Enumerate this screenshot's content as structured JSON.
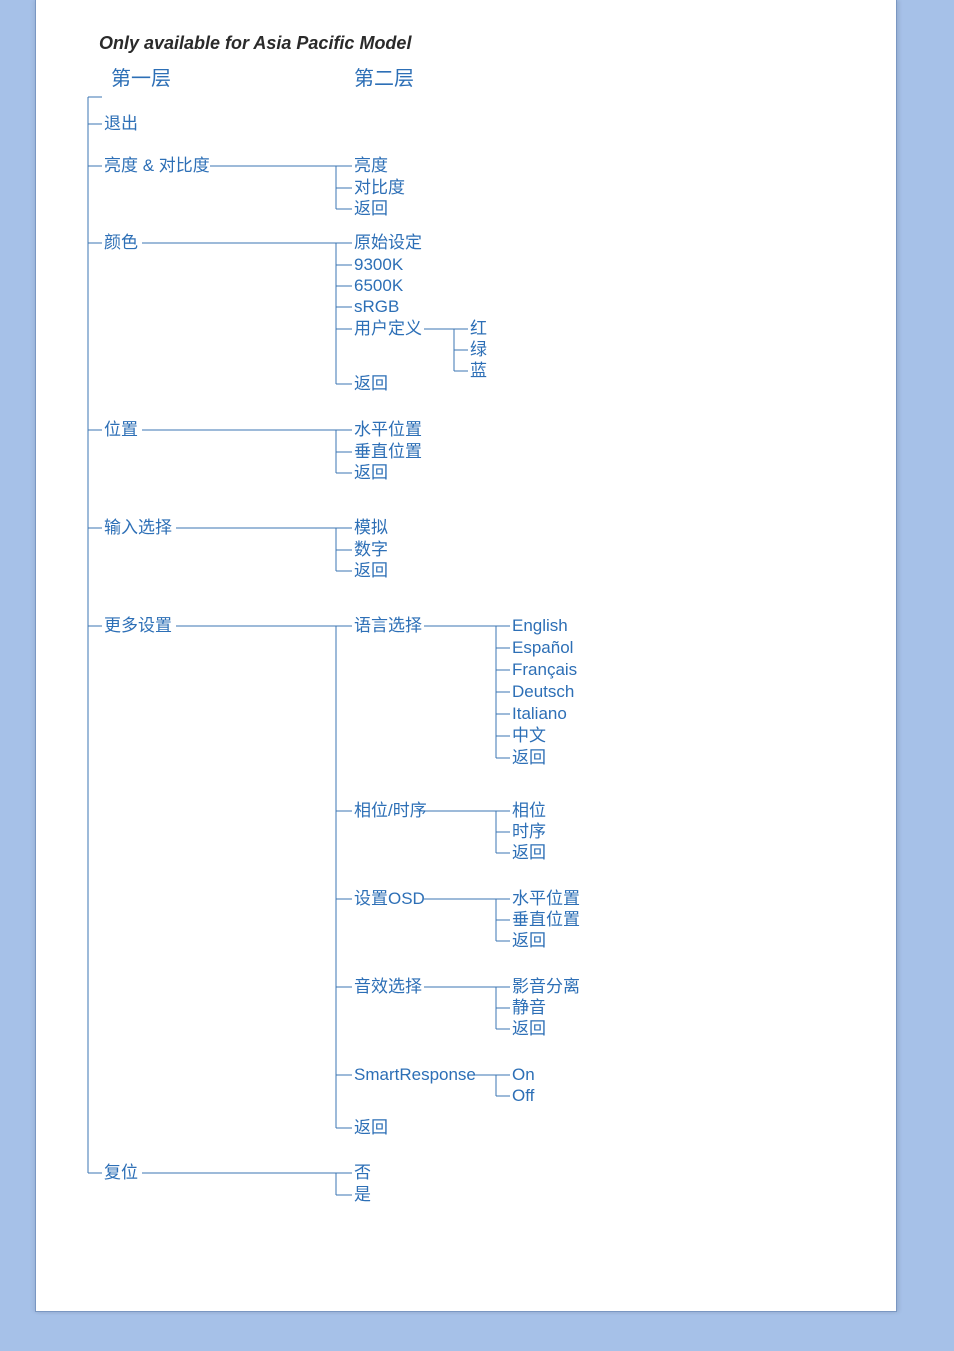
{
  "title": "Only available for Asia Pacific Model",
  "header_level1": "第一层",
  "header_level2": "第二层",
  "l1": {
    "exit": "退出",
    "brightness": "亮度 & 对比度",
    "color": "颜色",
    "position": "位置",
    "input": "输入选择",
    "more": "更多设置",
    "reset": "复位"
  },
  "brightness_sub": {
    "b": "亮度",
    "c": "对比度",
    "r": "返回"
  },
  "color_sub": {
    "orig": "原始设定",
    "k93": "9300K",
    "k65": "6500K",
    "srgb": "sRGB",
    "user": "用户定义",
    "ret": "返回"
  },
  "color_user_sub": {
    "r": "红",
    "g": "绿",
    "b": "蓝"
  },
  "position_sub": {
    "h": "水平位置",
    "v": "垂直位置",
    "r": "返回"
  },
  "input_sub": {
    "a": "模拟",
    "d": "数字",
    "r": "返回"
  },
  "more_sub": {
    "lang": "语言选择",
    "phase": "相位/时序",
    "osd": "设置OSD",
    "audio": "音效选择",
    "smart": "SmartResponse",
    "ret": "返回"
  },
  "lang_sub": {
    "en": "English",
    "es": "Español",
    "fr": "Français",
    "de": "Deutsch",
    "it": "Italiano",
    "zh": "中文",
    "ret": "返回"
  },
  "phase_sub": {
    "p": "相位",
    "c": "时序",
    "r": "返回"
  },
  "osd_sub": {
    "h": "水平位置",
    "v": "垂直位置",
    "r": "返回"
  },
  "audio_sub": {
    "sep": "影音分离",
    "mute": "静音",
    "r": "返回"
  },
  "smart_sub": {
    "on": "On",
    "off": "Off"
  },
  "reset_sub": {
    "no": "否",
    "yes": "是"
  }
}
